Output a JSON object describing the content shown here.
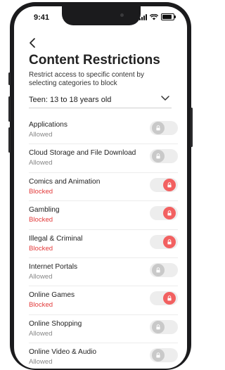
{
  "status_bar": {
    "time": "9:41"
  },
  "header": {
    "back_icon": "chevron-left-icon",
    "title": "Content Restrictions",
    "subtitle": "Restrict access to specific content by selecting categories to block"
  },
  "age_select": {
    "value": "Teen: 13 to 18 years old",
    "icon": "chevron-down-icon"
  },
  "colors": {
    "blocked": "#e23a3a",
    "toggle_on": "#f26060",
    "toggle_off": "#c9c9c9"
  },
  "categories": [
    {
      "name": "Applications",
      "status": "Allowed",
      "blocked": false
    },
    {
      "name": "Cloud Storage and File Download",
      "status": "Allowed",
      "blocked": false
    },
    {
      "name": "Comics and Animation",
      "status": "Blocked",
      "blocked": true
    },
    {
      "name": "Gambling",
      "status": "Blocked",
      "blocked": true
    },
    {
      "name": "Illegal & Criminal",
      "status": "Blocked",
      "blocked": true
    },
    {
      "name": "Internet Portals",
      "status": "Allowed",
      "blocked": false
    },
    {
      "name": "Online Games",
      "status": "Blocked",
      "blocked": true
    },
    {
      "name": "Online Shopping",
      "status": "Allowed",
      "blocked": false
    },
    {
      "name": "Online Video & Audio",
      "status": "Allowed",
      "blocked": false
    }
  ]
}
